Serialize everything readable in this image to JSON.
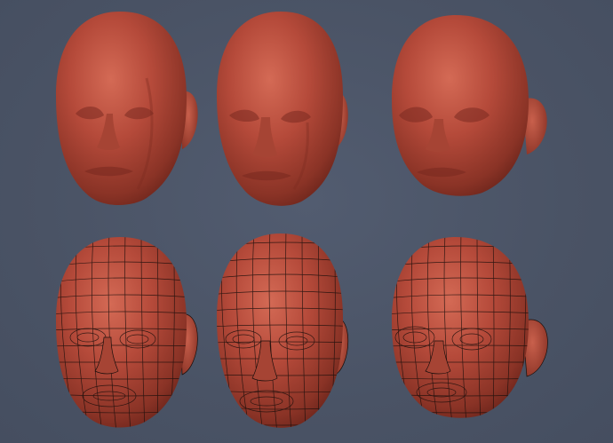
{
  "scene": {
    "background_color": "#4b5466",
    "clay_color": "#b54a3a",
    "clay_shadow_color": "#7a2a20",
    "clay_highlight_color": "#d9705c",
    "wire_color": "#1a0f0c"
  },
  "heads": [
    {
      "row": "sculpt",
      "style": "adult-male-1",
      "wireframe": false
    },
    {
      "row": "sculpt",
      "style": "adult-male-2",
      "wireframe": false
    },
    {
      "row": "sculpt",
      "style": "stylized-child",
      "wireframe": false
    },
    {
      "row": "retopo",
      "style": "adult-male-1",
      "wireframe": true
    },
    {
      "row": "retopo",
      "style": "adult-male-2",
      "wireframe": true
    },
    {
      "row": "retopo",
      "style": "stylized-child",
      "wireframe": true
    }
  ]
}
